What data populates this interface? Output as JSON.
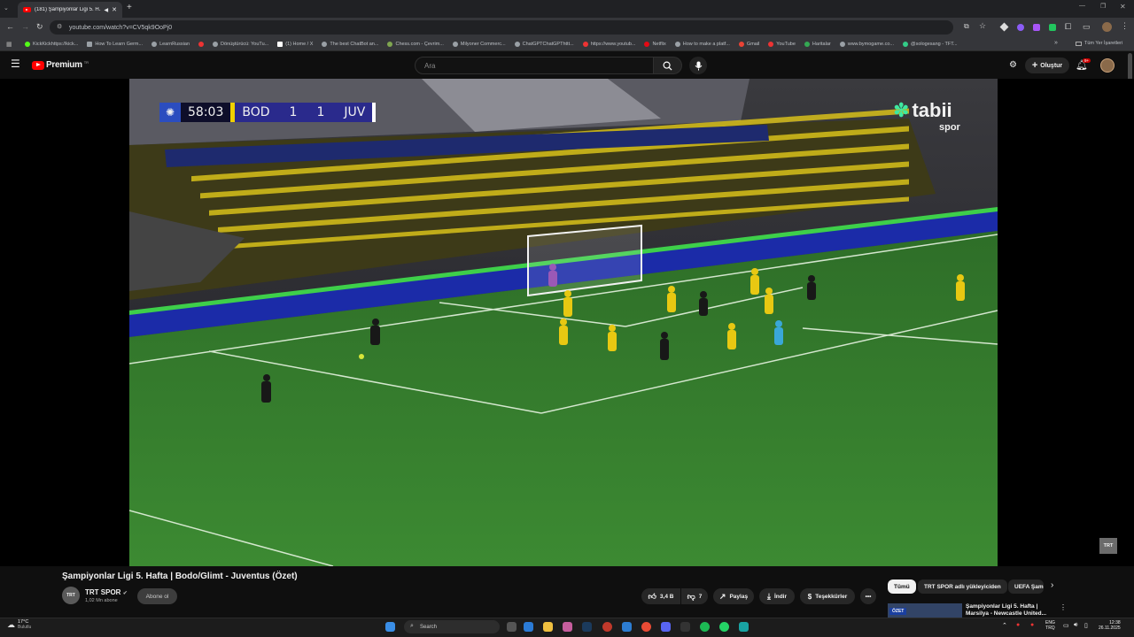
{
  "browser": {
    "tab_title": "(181) Şampiyonlar Ligi 5. H...",
    "url": "youtube.com/watch?v=CV5qk9OoPj0",
    "bookmarks": [
      "KickKickhttps://kick...",
      "How To Learn Germ...",
      "LearnRussian",
      "Dönüştürücü: YouTu...",
      "(1) Home / X",
      "The best ChatBot an...",
      "Chess.com - Çevrim...",
      "Milyoner Commerc...",
      "ChatGPTChatGPThttt...",
      "https://www.youtub...",
      "Netflix",
      "How to make a platf...",
      "Gmail",
      "YouTube",
      "Haritalar",
      "www.bymogame.co...",
      "@sologesang - TFT..."
    ],
    "all_bookmarks": "Tüm Yer İşaretleri"
  },
  "youtube": {
    "logo": "Premium",
    "logo_sup": "TR",
    "search_placeholder": "Ara",
    "create_label": "Oluştur",
    "notif_badge": "9+"
  },
  "scoreboard": {
    "time": "58:03",
    "home": "BOD",
    "home_score": "1",
    "away_score": "1",
    "away": "JUV"
  },
  "broadcaster": {
    "name": "tabii",
    "sub": "spor",
    "corner": "TRT"
  },
  "video": {
    "title": "Şampiyonlar Ligi 5. Hafta | Bodo/Glimt - Juventus (Özet)",
    "channel": "TRT SPOR",
    "channel_avatar": "TRT",
    "subscribers": "1,02 Mn abone",
    "subscribe_label": "Abone ol",
    "likes": "3,4 B",
    "dislikes": "7",
    "share_label": "Paylaş",
    "download_label": "İndir",
    "thanks_label": "Teşekkürler"
  },
  "chips": [
    "Tümü",
    "TRT SPOR adlı yükleyiciden",
    "UEFA Şam"
  ],
  "recommendation": {
    "thumb_label": "ÖZET",
    "title": "Şampiyonlar Ligi 5. Hafta | Marsilya - Newcastle United..."
  },
  "taskbar": {
    "weather_temp": "17°C",
    "weather_desc": "Bulutlu",
    "search": "Search",
    "lang": "ENG",
    "lang_sub": "TRQ",
    "time": "12:38",
    "date": "26.11.2025"
  },
  "colors": {
    "youtube_red": "#ff0000",
    "pitch": "#2f7d32",
    "bodo_yellow": "#f0d000",
    "juve_black": "#1a1a1a",
    "scoreboard_blue": "#2a2a8c"
  }
}
